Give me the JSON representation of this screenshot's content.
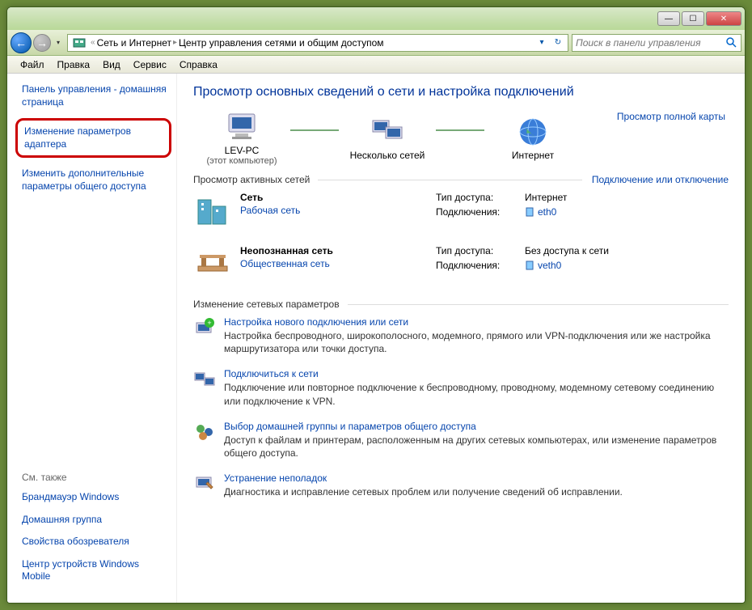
{
  "titlebar": {
    "min": "—",
    "max": "☐",
    "close": "✕"
  },
  "nav": {
    "back": "←",
    "fwd": "→",
    "drop": "▾",
    "path_prefix": "«",
    "path1": "Сеть и Интернет",
    "path2": "Центр управления сетями и общим доступом",
    "refresh": "↻",
    "drop2": "▾"
  },
  "search": {
    "placeholder": "Поиск в панели управления"
  },
  "menu": {
    "file": "Файл",
    "edit": "Правка",
    "view": "Вид",
    "tools": "Сервис",
    "help": "Справка"
  },
  "sidebar": {
    "home": "Панель управления - домашняя страница",
    "adapter": "Изменение параметров адаптера",
    "sharing": "Изменить дополнительные параметры общего доступа",
    "seealso": "См. также",
    "firewall": "Брандмауэр Windows",
    "homegroup": "Домашняя группа",
    "browser": "Свойства обозревателя",
    "mobile": "Центр устройств Windows Mobile"
  },
  "main": {
    "heading": "Просмотр основных сведений о сети и настройка подключений",
    "fullmap": "Просмотр полной карты",
    "node1": "LEV-PC",
    "node1sub": "(этот компьютер)",
    "node2": "Несколько сетей",
    "node3": "Интернет",
    "active_title": "Просмотр активных сетей",
    "active_link": "Подключение или отключение",
    "net1": {
      "name": "Сеть",
      "type": "Рабочая сеть",
      "access_k": "Тип доступа:",
      "access_v": "Интернет",
      "conn_k": "Подключения:",
      "conn_v": "eth0"
    },
    "net2": {
      "name": "Неопознанная сеть",
      "type": "Общественная сеть",
      "access_k": "Тип доступа:",
      "access_v": "Без доступа к сети",
      "conn_k": "Подключения:",
      "conn_v": "veth0"
    },
    "params_title": "Изменение сетевых параметров",
    "s1": {
      "title": "Настройка нового подключения или сети",
      "desc": "Настройка беспроводного, широкополосного, модемного, прямого или VPN-подключения или же настройка маршрутизатора или точки доступа."
    },
    "s2": {
      "title": "Подключиться к сети",
      "desc": "Подключение или повторное подключение к беспроводному, проводному, модемному сетевому соединению или подключение к VPN."
    },
    "s3": {
      "title": "Выбор домашней группы и параметров общего доступа",
      "desc": "Доступ к файлам и принтерам, расположенным на других сетевых компьютерах, или изменение параметров общего доступа."
    },
    "s4": {
      "title": "Устранение неполадок",
      "desc": "Диагностика и исправление сетевых проблем или получение сведений об исправлении."
    }
  }
}
